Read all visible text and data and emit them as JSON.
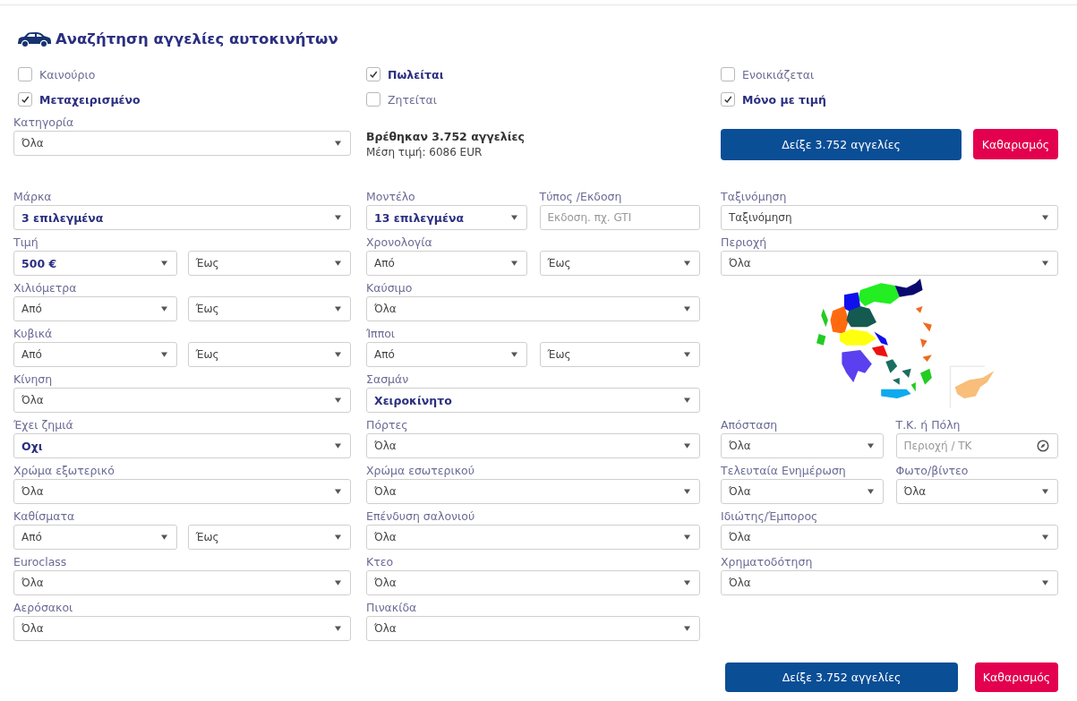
{
  "title": "Αναζήτηση αγγελίες αυτοκινήτων",
  "checkbox_columns": [
    [
      {
        "label": "Καινούριο",
        "checked": false
      },
      {
        "label": "Μεταχειρισμένο",
        "checked": true
      }
    ],
    [
      {
        "label": "Πωλείται",
        "checked": true
      },
      {
        "label": "Ζητείται",
        "checked": false
      }
    ],
    [
      {
        "label": "Ενοικιάζεται",
        "checked": false
      },
      {
        "label": "Μόνο με τιμή",
        "checked": true
      }
    ]
  ],
  "category": {
    "label": "Κατηγορία",
    "value": "Όλα",
    "bold": false
  },
  "summary": {
    "found": "Βρέθηκαν 3.752 αγγελίες",
    "average": "Μέση τιμή: 6086 EUR"
  },
  "top_buttons": {
    "show": "Δείξε 3.752 αγγελίες",
    "clear": "Καθαρισμός"
  },
  "columns": [
    [
      {
        "kind": "fields",
        "fields": [
          {
            "label": "Μάρκα",
            "control": {
              "kind": "select",
              "value": "3 επιλεγμένα",
              "bold": true
            }
          }
        ]
      },
      {
        "kind": "fields",
        "fields": [
          {
            "label": "Τιμή",
            "control": {
              "kind": "select",
              "value": "500 €",
              "bold": true
            }
          },
          {
            "control": {
              "kind": "select",
              "value": "Έως",
              "bold": false
            }
          }
        ]
      },
      {
        "kind": "fields",
        "fields": [
          {
            "label": "Χιλιόμετρα",
            "control": {
              "kind": "select",
              "value": "Από",
              "bold": false
            }
          },
          {
            "control": {
              "kind": "select",
              "value": "Έως",
              "bold": false
            }
          }
        ]
      },
      {
        "kind": "fields",
        "fields": [
          {
            "label": "Κυβικά",
            "control": {
              "kind": "select",
              "value": "Από",
              "bold": false
            }
          },
          {
            "control": {
              "kind": "select",
              "value": "Έως",
              "bold": false
            }
          }
        ]
      },
      {
        "kind": "fields",
        "fields": [
          {
            "label": "Κίνηση",
            "control": {
              "kind": "select",
              "value": "Όλα",
              "bold": false
            }
          }
        ]
      },
      {
        "kind": "fields",
        "fields": [
          {
            "label": "Έχει ζημιά",
            "control": {
              "kind": "select",
              "value": "Οχι",
              "bold": true
            }
          }
        ]
      },
      {
        "kind": "fields",
        "fields": [
          {
            "label": "Χρώμα εξωτερικό",
            "control": {
              "kind": "select",
              "value": "Όλα",
              "bold": false
            }
          }
        ]
      },
      {
        "kind": "fields",
        "fields": [
          {
            "label": "Καθίσματα",
            "control": {
              "kind": "select",
              "value": "Από",
              "bold": false
            }
          },
          {
            "control": {
              "kind": "select",
              "value": "Έως",
              "bold": false
            }
          }
        ]
      },
      {
        "kind": "fields",
        "fields": [
          {
            "label": "Euroclass",
            "control": {
              "kind": "select",
              "value": "Όλα",
              "bold": false
            }
          }
        ]
      },
      {
        "kind": "fields",
        "fields": [
          {
            "label": "Αερόσακοι",
            "control": {
              "kind": "select",
              "value": "Όλα",
              "bold": false
            }
          }
        ]
      }
    ],
    [
      {
        "kind": "fields",
        "fields": [
          {
            "label": "Μοντέλο",
            "control": {
              "kind": "select",
              "value": "13 επιλεγμένα",
              "bold": true
            }
          },
          {
            "label": "Τύπος /Εκδοση",
            "control": {
              "kind": "input",
              "placeholder": "Εκδοση. πχ. GTI"
            }
          }
        ]
      },
      {
        "kind": "fields",
        "fields": [
          {
            "label": "Χρονολογία",
            "control": {
              "kind": "select",
              "value": "Από",
              "bold": false
            }
          },
          {
            "control": {
              "kind": "select",
              "value": "Έως",
              "bold": false
            }
          }
        ]
      },
      {
        "kind": "fields",
        "fields": [
          {
            "label": "Καύσιμο",
            "control": {
              "kind": "select",
              "value": "Όλα",
              "bold": false
            }
          }
        ]
      },
      {
        "kind": "fields",
        "fields": [
          {
            "label": "Ίπποι",
            "control": {
              "kind": "select",
              "value": "Από",
              "bold": false
            }
          },
          {
            "control": {
              "kind": "select",
              "value": "Έως",
              "bold": false
            }
          }
        ]
      },
      {
        "kind": "fields",
        "fields": [
          {
            "label": "Σασμάν",
            "control": {
              "kind": "select",
              "value": "Χειροκίνητο",
              "bold": true
            }
          }
        ]
      },
      {
        "kind": "fields",
        "fields": [
          {
            "label": "Πόρτες",
            "control": {
              "kind": "select",
              "value": "Όλα",
              "bold": false
            }
          }
        ]
      },
      {
        "kind": "fields",
        "fields": [
          {
            "label": "Χρώμα εσωτερικού",
            "control": {
              "kind": "select",
              "value": "Όλα",
              "bold": false
            }
          }
        ]
      },
      {
        "kind": "fields",
        "fields": [
          {
            "label": "Επένδυση σαλονιού",
            "control": {
              "kind": "select",
              "value": "Όλα",
              "bold": false
            }
          }
        ]
      },
      {
        "kind": "fields",
        "fields": [
          {
            "label": "Κτεο",
            "control": {
              "kind": "select",
              "value": "Όλα",
              "bold": false
            }
          }
        ]
      },
      {
        "kind": "fields",
        "fields": [
          {
            "label": "Πινακίδα",
            "control": {
              "kind": "select",
              "value": "Όλα",
              "bold": false
            }
          }
        ]
      }
    ],
    [
      {
        "kind": "fields",
        "fields": [
          {
            "label": "Ταξινόμηση",
            "control": {
              "kind": "select",
              "value": "Ταξινόμηση",
              "bold": false
            }
          }
        ]
      },
      {
        "kind": "fields",
        "fields": [
          {
            "label": "Περιοχή",
            "control": {
              "kind": "select",
              "value": "Όλα",
              "bold": false
            }
          }
        ]
      },
      {
        "kind": "map"
      },
      {
        "kind": "fields",
        "fields": [
          {
            "label": "Απόσταση",
            "control": {
              "kind": "select",
              "value": "Όλα",
              "bold": false
            }
          },
          {
            "label": "Τ.Κ. ή Πόλη",
            "control": {
              "kind": "location_input",
              "placeholder": "Περιοχή / ΤΚ"
            }
          }
        ]
      },
      {
        "kind": "fields",
        "fields": [
          {
            "label": "Τελευταία Ενημέρωση",
            "control": {
              "kind": "select",
              "value": "Όλα",
              "bold": false
            }
          },
          {
            "label": "Φωτο/βίντεο",
            "control": {
              "kind": "select",
              "value": "Όλα",
              "bold": false
            }
          }
        ]
      },
      {
        "kind": "fields",
        "fields": [
          {
            "label": "Ιδιώτης/Έμπορος",
            "control": {
              "kind": "select",
              "value": "Όλα",
              "bold": false
            }
          }
        ]
      },
      {
        "kind": "fields",
        "fields": [
          {
            "label": "Χρηματοδότηση",
            "control": {
              "kind": "select",
              "value": "Όλα",
              "bold": false
            }
          }
        ]
      }
    ]
  ],
  "bottom_buttons": {
    "show": "Δείξε 3.752 αγγελίες",
    "clear": "Καθαρισμός"
  }
}
